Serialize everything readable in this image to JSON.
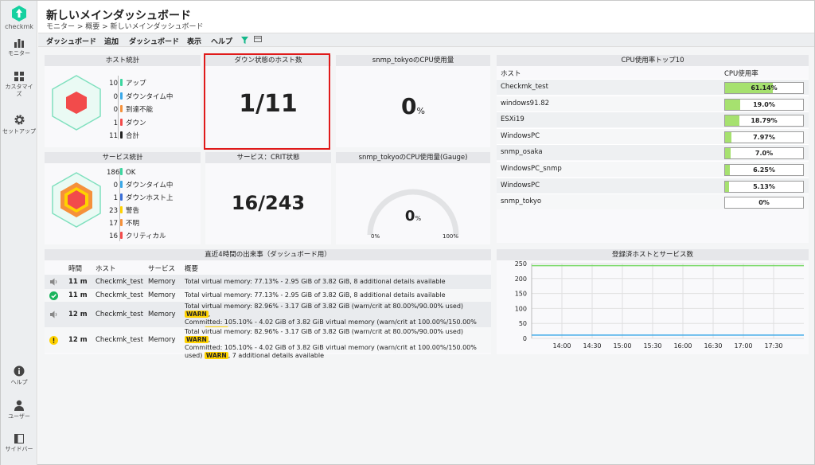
{
  "sidebar": {
    "logo_text": "checkmk",
    "items": [
      {
        "label": "モニター",
        "icon": "bar-chart-icon"
      },
      {
        "label": "カスタマイズ",
        "icon": "grid-icon"
      },
      {
        "label": "セットアップ",
        "icon": "gear-icon"
      }
    ],
    "bottom_items": [
      {
        "label": "ヘルプ",
        "icon": "info-icon"
      },
      {
        "label": "ユーザー",
        "icon": "user-icon"
      },
      {
        "label": "サイドバー",
        "icon": "sidebar-icon"
      }
    ]
  },
  "header": {
    "title": "新しいメインダッシュボード",
    "breadcrumb": "モニター > 概要 > 新しいメインダッシュボード"
  },
  "menu": [
    "ダッシュボード",
    "追加",
    "ダッシュボード",
    "表示",
    "ヘルプ"
  ],
  "host_stats": {
    "title": "ホスト統計",
    "rows": [
      {
        "count": "10",
        "label": "アップ",
        "color": "#3dd6a0"
      },
      {
        "count": "0",
        "label": "ダウンタイム中",
        "color": "#3aa8e8"
      },
      {
        "count": "0",
        "label": "到達不能",
        "color": "#f5913b"
      },
      {
        "count": "1",
        "label": "ダウン",
        "color": "#f24b4b"
      },
      {
        "count": "11",
        "label": "合計",
        "color": "#222222"
      }
    ]
  },
  "down_hosts": {
    "title": "ダウン状態のホスト数",
    "value": "1/11"
  },
  "cpu_usage": {
    "title": "snmp_tokyoのCPU使用量",
    "value": "0",
    "unit": "%"
  },
  "cpu_top": {
    "title": "CPU使用率トップ10",
    "col_host": "ホスト",
    "col_cpu": "CPU使用率",
    "rows": [
      {
        "host": "Checkmk_test",
        "value": "61.14%",
        "pct": 61.14
      },
      {
        "host": "windows91.82",
        "value": "19.0%",
        "pct": 19.0
      },
      {
        "host": "ESXi19",
        "value": "18.79%",
        "pct": 18.79
      },
      {
        "host": "WindowsPC",
        "value": "7.97%",
        "pct": 7.97
      },
      {
        "host": "snmp_osaka",
        "value": "7.0%",
        "pct": 7.0
      },
      {
        "host": "WindowsPC_snmp",
        "value": "6.25%",
        "pct": 6.25
      },
      {
        "host": "WindowsPC",
        "value": "5.13%",
        "pct": 5.13
      },
      {
        "host": "snmp_tokyo",
        "value": "0%",
        "pct": 0
      }
    ]
  },
  "service_stats": {
    "title": "サービス統計",
    "rows": [
      {
        "count": "186",
        "label": "OK",
        "color": "#3dd6a0"
      },
      {
        "count": "0",
        "label": "ダウンタイム中",
        "color": "#3aa8e8"
      },
      {
        "count": "1",
        "label": "ダウンホスト上",
        "color": "#3a6fd8"
      },
      {
        "count": "23",
        "label": "警告",
        "color": "#ffd200"
      },
      {
        "count": "17",
        "label": "不明",
        "color": "#f5913b"
      },
      {
        "count": "16",
        "label": "クリティカル",
        "color": "#f24b4b"
      }
    ]
  },
  "crit_services": {
    "title": "サービス：CRIT状態",
    "value": "16/243"
  },
  "gauge": {
    "title": "snmp_tokyoのCPU使用量(Gauge)",
    "value": "0",
    "unit": "%",
    "min_label": "0%",
    "max_label": "100%",
    "level": 0
  },
  "events": {
    "title": "直近4時間の出来事（ダッシュボード用）",
    "columns": [
      "時間",
      "ホスト",
      "サービス",
      "概要"
    ],
    "rows": [
      {
        "icon": "speaker-icon",
        "time": "11 m",
        "host": "Checkmk_test",
        "service": "Memory",
        "lines": [
          "Total virtual memory: 77.13% - 2.95 GiB of 3.82 GiB, 8 additional details available"
        ]
      },
      {
        "icon": "check-circle-icon",
        "time": "11 m",
        "host": "Checkmk_test",
        "service": "Memory",
        "lines": [
          "Total virtual memory: 77.13% - 2.95 GiB of 3.82 GiB, 8 additional details available"
        ]
      },
      {
        "icon": "speaker-icon",
        "time": "12 m",
        "host": "Checkmk_test",
        "service": "Memory",
        "lines": [
          "Total virtual memory: 82.96% - 3.17 GiB of 3.82 GiB (warn/crit at 80.00%/90.00% used)",
          "Committed: 105.10% - 4.02 GiB of 3.82 GiB virtual memory (warn/crit at 100.00%/150.00%",
          "used)",
          ", 7 additional details available"
        ]
      },
      {
        "icon": "warning-circle-icon",
        "time": "12 m",
        "host": "Checkmk_test",
        "service": "Memory",
        "lines": [
          "Total virtual memory: 82.96% - 3.17 GiB of 3.82 GiB (warn/crit at 80.00%/90.00% used)",
          "Committed: 105.10% - 4.02 GiB of 3.82 GiB virtual memory (warn/crit at 100.00%/150.00%",
          "used)",
          ", 7 additional details available"
        ]
      }
    ],
    "warn_label": "WARN"
  },
  "chart_data": {
    "type": "line",
    "title": "登録済ホストとサービス数",
    "x": [
      "13:40",
      "14:00",
      "14:30",
      "15:00",
      "15:30",
      "16:00",
      "16:30",
      "17:00",
      "17:30",
      "17:50"
    ],
    "x_ticks": [
      "14:00",
      "14:30",
      "15:00",
      "15:30",
      "16:00",
      "16:30",
      "17:00",
      "17:30"
    ],
    "y_ticks": [
      "250",
      "200",
      "150",
      "100",
      "50",
      "0"
    ],
    "ylim": [
      0,
      250
    ],
    "series": [
      {
        "values": [
          243,
          243,
          243,
          243,
          243,
          243,
          243,
          243,
          243,
          243
        ],
        "color": "#7bd96a"
      },
      {
        "values": [
          11,
          11,
          11,
          11,
          11,
          11,
          11,
          11,
          11,
          11
        ],
        "color": "#3aa8e8"
      }
    ],
    "grid": true
  }
}
